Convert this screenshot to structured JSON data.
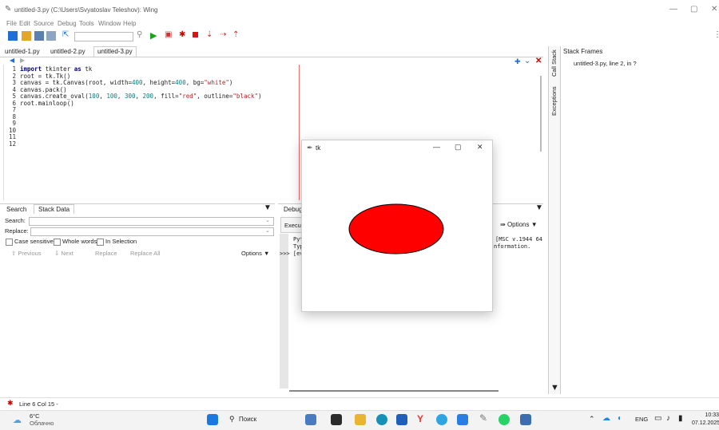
{
  "window": {
    "title": "untitled-3.py (C:\\Users\\Svyatoslav Teleshov): Wing"
  },
  "menu": [
    "File",
    "Edit",
    "Source",
    "Debug",
    "Tools",
    "Window",
    "Help"
  ],
  "editor": {
    "tabs": [
      "untitled-1.py",
      "untitled-2.py",
      "untitled-3.py"
    ],
    "line_numbers": [
      "1",
      "2",
      "3",
      "4",
      "5",
      "6",
      "7",
      "8",
      "9",
      "10",
      "11",
      "12"
    ],
    "lines": [
      {
        "kw": "import",
        "rest": " tkinter ",
        "kw2": "as",
        "rest2": " tk"
      },
      {
        "plain": "root = tk.Tk()"
      },
      {
        "a": "canvas = tk.Canvas(root, width=",
        "n1": "400",
        "b": ", height=",
        "n2": "400",
        "c": ", bg=",
        "s1": "\"white\"",
        "d": ")"
      },
      {
        "plain": "canvas.pack()"
      },
      {
        "a": "canvas.create_oval(",
        "n1": "100",
        "b": ", ",
        "n2": "100",
        "c": ", ",
        "n3": "300",
        "d": ", ",
        "n4": "200",
        "e": ", fill=",
        "s1": "\"red\"",
        "f": ", outline=",
        "s2": "\"black\"",
        "g": ")"
      },
      {
        "plain": "root.mainloop()"
      }
    ]
  },
  "side_panel": {
    "vtabs": [
      "Call Stack",
      "Exceptions"
    ],
    "header": "Stack Frames",
    "frame": "untitled-3.py, line 2, in ?"
  },
  "search_panel": {
    "tabs": [
      "Search",
      "Stack Data"
    ],
    "search_label": "Search:",
    "replace_label": "Replace:",
    "case_sensitive": "Case sensitive",
    "whole_words": "Whole words",
    "in_selection": "In Selection",
    "previous": "Previous",
    "next": "Next",
    "replace": "Replace",
    "replace_all": "Replace All",
    "options": "Options"
  },
  "debug_panel": {
    "tab": "Debug",
    "exec_label": "Execut",
    "options": "Options",
    "shell_line1_left": "Pyt",
    "shell_line2_left": "Typ",
    "shell_line3_left": ">>> [ev",
    "shell_line1_right": "[MSC v.1944 64",
    "shell_line2_right": "nformation."
  },
  "status": {
    "text": "Line 6 Col 15 -"
  },
  "tk_window": {
    "title": "tk",
    "oval_fill": "#ff0000",
    "oval_outline": "#000000"
  },
  "taskbar": {
    "weather_temp": "6°C",
    "weather_desc": "Облачно",
    "search": "Поиск",
    "lang": "ENG",
    "time": "10:33",
    "date": "07.12.2025"
  }
}
